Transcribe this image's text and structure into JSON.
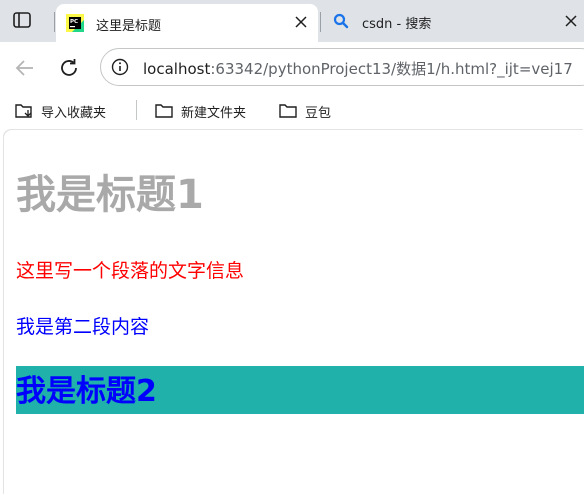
{
  "browser": {
    "tabs": [
      {
        "title": "这里是标题",
        "favicon": "pycharm-icon",
        "active": true
      },
      {
        "title": "csdn - 搜索",
        "favicon": "search-icon",
        "active": false
      }
    ],
    "address_bar": {
      "host": "localhost",
      "path": ":63342/pythonProject13/数据1/h.html?_ijt=vej17"
    },
    "bookmarks": [
      {
        "label": "导入收藏夹",
        "icon": "import-icon"
      },
      {
        "label": "新建文件夹",
        "icon": "folder-icon"
      },
      {
        "label": "豆包",
        "icon": "folder-icon"
      }
    ]
  },
  "page": {
    "heading1": "我是标题1",
    "paragraph1": "这里写一个段落的文字信息",
    "paragraph2": "我是第二段内容",
    "heading2": "我是标题2"
  },
  "colors": {
    "heading1": "#a9a9a9",
    "paragraph1": "#ff0000",
    "paragraph2": "#0000ff",
    "heading2_text": "#0000ff",
    "heading2_background": "#20b2aa"
  }
}
